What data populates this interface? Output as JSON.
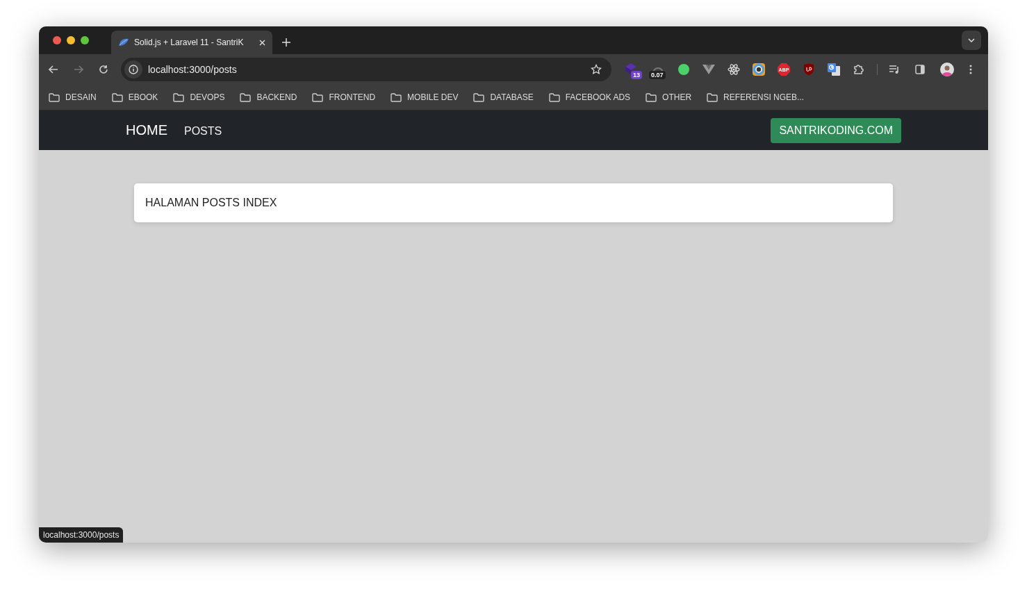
{
  "tabs": [
    {
      "title": "Solid.js + Laravel 11 - SantriK",
      "selected": true
    }
  ],
  "toolbar": {
    "url": "localhost:3000/posts"
  },
  "extensions": [
    {
      "kind": "cube",
      "badge": "13"
    },
    {
      "kind": "gauge",
      "badge": "0.07"
    },
    {
      "kind": "dot"
    },
    {
      "kind": "vee"
    },
    {
      "kind": "atom"
    },
    {
      "kind": "ring"
    },
    {
      "kind": "octagon",
      "label": "ABP"
    },
    {
      "kind": "shield"
    },
    {
      "kind": "translate"
    },
    {
      "kind": "puzzle"
    }
  ],
  "bookmarks": [
    "DESAIN",
    "EBOOK",
    "DEVOPS",
    "BACKEND",
    "FRONTEND",
    "MOBILE DEV",
    "DATABASE",
    "FACEBOOK ADS",
    "OTHER",
    "REFERENSI NGEB..."
  ],
  "navbar": {
    "links": [
      {
        "kind": "brand",
        "label": "HOME"
      },
      {
        "kind": "link",
        "label": "POSTS"
      }
    ],
    "button": "SANTRIKODING.COM"
  },
  "card": {
    "title": "HALAMAN POSTS INDEX"
  },
  "status_link": "localhost:3000/posts"
}
